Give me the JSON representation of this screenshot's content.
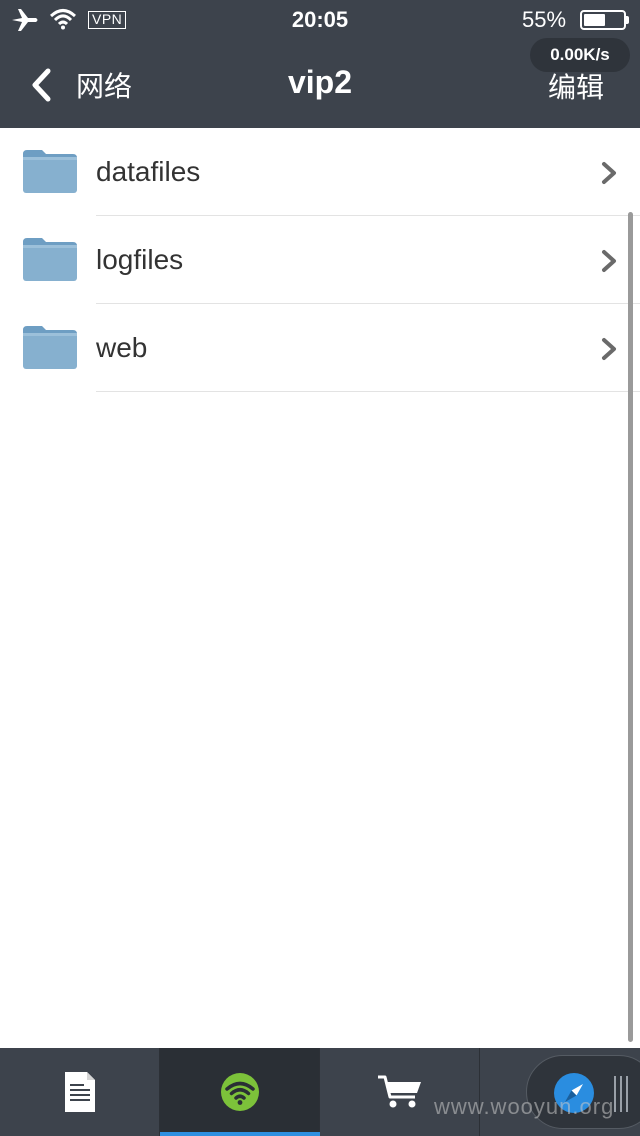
{
  "status_bar": {
    "time": "20:05",
    "vpn": "VPN",
    "battery_pct": "55%",
    "battery_level": 0.55
  },
  "speed_badge": "0.00K/s",
  "nav": {
    "back_label": "网络",
    "title": "vip2",
    "edit_label": "编辑"
  },
  "files": [
    {
      "name": "datafiles",
      "icon": "folder-icon"
    },
    {
      "name": "logfiles",
      "icon": "folder-icon"
    },
    {
      "name": "web",
      "icon": "folder-icon"
    }
  ],
  "tabs": [
    {
      "icon": "document-icon",
      "active": false
    },
    {
      "icon": "wifi-icon",
      "active": true
    },
    {
      "icon": "cart-icon",
      "active": false
    },
    {
      "icon": "compass-icon",
      "active": false
    }
  ],
  "colors": {
    "bar_bg": "#3d434c",
    "folder": "#86b0cf",
    "wifi_green": "#7cc23a",
    "active_underline": "#2e8fe0",
    "compass_blue": "#2a8de0"
  },
  "watermark": "www.wooyun.org"
}
